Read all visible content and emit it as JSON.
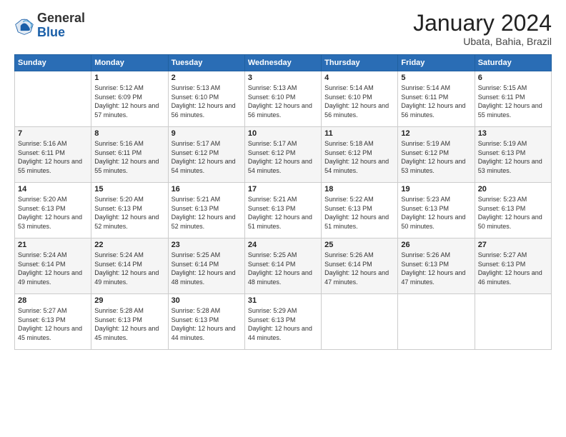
{
  "logo": {
    "general": "General",
    "blue": "Blue"
  },
  "header": {
    "month": "January 2024",
    "location": "Ubata, Bahia, Brazil"
  },
  "weekdays": [
    "Sunday",
    "Monday",
    "Tuesday",
    "Wednesday",
    "Thursday",
    "Friday",
    "Saturday"
  ],
  "weeks": [
    [
      {
        "day": "",
        "sunrise": "",
        "sunset": "",
        "daylight": ""
      },
      {
        "day": "1",
        "sunrise": "Sunrise: 5:12 AM",
        "sunset": "Sunset: 6:09 PM",
        "daylight": "Daylight: 12 hours and 57 minutes."
      },
      {
        "day": "2",
        "sunrise": "Sunrise: 5:13 AM",
        "sunset": "Sunset: 6:10 PM",
        "daylight": "Daylight: 12 hours and 56 minutes."
      },
      {
        "day": "3",
        "sunrise": "Sunrise: 5:13 AM",
        "sunset": "Sunset: 6:10 PM",
        "daylight": "Daylight: 12 hours and 56 minutes."
      },
      {
        "day": "4",
        "sunrise": "Sunrise: 5:14 AM",
        "sunset": "Sunset: 6:10 PM",
        "daylight": "Daylight: 12 hours and 56 minutes."
      },
      {
        "day": "5",
        "sunrise": "Sunrise: 5:14 AM",
        "sunset": "Sunset: 6:11 PM",
        "daylight": "Daylight: 12 hours and 56 minutes."
      },
      {
        "day": "6",
        "sunrise": "Sunrise: 5:15 AM",
        "sunset": "Sunset: 6:11 PM",
        "daylight": "Daylight: 12 hours and 55 minutes."
      }
    ],
    [
      {
        "day": "7",
        "sunrise": "Sunrise: 5:16 AM",
        "sunset": "Sunset: 6:11 PM",
        "daylight": "Daylight: 12 hours and 55 minutes."
      },
      {
        "day": "8",
        "sunrise": "Sunrise: 5:16 AM",
        "sunset": "Sunset: 6:11 PM",
        "daylight": "Daylight: 12 hours and 55 minutes."
      },
      {
        "day": "9",
        "sunrise": "Sunrise: 5:17 AM",
        "sunset": "Sunset: 6:12 PM",
        "daylight": "Daylight: 12 hours and 54 minutes."
      },
      {
        "day": "10",
        "sunrise": "Sunrise: 5:17 AM",
        "sunset": "Sunset: 6:12 PM",
        "daylight": "Daylight: 12 hours and 54 minutes."
      },
      {
        "day": "11",
        "sunrise": "Sunrise: 5:18 AM",
        "sunset": "Sunset: 6:12 PM",
        "daylight": "Daylight: 12 hours and 54 minutes."
      },
      {
        "day": "12",
        "sunrise": "Sunrise: 5:19 AM",
        "sunset": "Sunset: 6:12 PM",
        "daylight": "Daylight: 12 hours and 53 minutes."
      },
      {
        "day": "13",
        "sunrise": "Sunrise: 5:19 AM",
        "sunset": "Sunset: 6:13 PM",
        "daylight": "Daylight: 12 hours and 53 minutes."
      }
    ],
    [
      {
        "day": "14",
        "sunrise": "Sunrise: 5:20 AM",
        "sunset": "Sunset: 6:13 PM",
        "daylight": "Daylight: 12 hours and 53 minutes."
      },
      {
        "day": "15",
        "sunrise": "Sunrise: 5:20 AM",
        "sunset": "Sunset: 6:13 PM",
        "daylight": "Daylight: 12 hours and 52 minutes."
      },
      {
        "day": "16",
        "sunrise": "Sunrise: 5:21 AM",
        "sunset": "Sunset: 6:13 PM",
        "daylight": "Daylight: 12 hours and 52 minutes."
      },
      {
        "day": "17",
        "sunrise": "Sunrise: 5:21 AM",
        "sunset": "Sunset: 6:13 PM",
        "daylight": "Daylight: 12 hours and 51 minutes."
      },
      {
        "day": "18",
        "sunrise": "Sunrise: 5:22 AM",
        "sunset": "Sunset: 6:13 PM",
        "daylight": "Daylight: 12 hours and 51 minutes."
      },
      {
        "day": "19",
        "sunrise": "Sunrise: 5:23 AM",
        "sunset": "Sunset: 6:13 PM",
        "daylight": "Daylight: 12 hours and 50 minutes."
      },
      {
        "day": "20",
        "sunrise": "Sunrise: 5:23 AM",
        "sunset": "Sunset: 6:13 PM",
        "daylight": "Daylight: 12 hours and 50 minutes."
      }
    ],
    [
      {
        "day": "21",
        "sunrise": "Sunrise: 5:24 AM",
        "sunset": "Sunset: 6:14 PM",
        "daylight": "Daylight: 12 hours and 49 minutes."
      },
      {
        "day": "22",
        "sunrise": "Sunrise: 5:24 AM",
        "sunset": "Sunset: 6:14 PM",
        "daylight": "Daylight: 12 hours and 49 minutes."
      },
      {
        "day": "23",
        "sunrise": "Sunrise: 5:25 AM",
        "sunset": "Sunset: 6:14 PM",
        "daylight": "Daylight: 12 hours and 48 minutes."
      },
      {
        "day": "24",
        "sunrise": "Sunrise: 5:25 AM",
        "sunset": "Sunset: 6:14 PM",
        "daylight": "Daylight: 12 hours and 48 minutes."
      },
      {
        "day": "25",
        "sunrise": "Sunrise: 5:26 AM",
        "sunset": "Sunset: 6:14 PM",
        "daylight": "Daylight: 12 hours and 47 minutes."
      },
      {
        "day": "26",
        "sunrise": "Sunrise: 5:26 AM",
        "sunset": "Sunset: 6:13 PM",
        "daylight": "Daylight: 12 hours and 47 minutes."
      },
      {
        "day": "27",
        "sunrise": "Sunrise: 5:27 AM",
        "sunset": "Sunset: 6:13 PM",
        "daylight": "Daylight: 12 hours and 46 minutes."
      }
    ],
    [
      {
        "day": "28",
        "sunrise": "Sunrise: 5:27 AM",
        "sunset": "Sunset: 6:13 PM",
        "daylight": "Daylight: 12 hours and 45 minutes."
      },
      {
        "day": "29",
        "sunrise": "Sunrise: 5:28 AM",
        "sunset": "Sunset: 6:13 PM",
        "daylight": "Daylight: 12 hours and 45 minutes."
      },
      {
        "day": "30",
        "sunrise": "Sunrise: 5:28 AM",
        "sunset": "Sunset: 6:13 PM",
        "daylight": "Daylight: 12 hours and 44 minutes."
      },
      {
        "day": "31",
        "sunrise": "Sunrise: 5:29 AM",
        "sunset": "Sunset: 6:13 PM",
        "daylight": "Daylight: 12 hours and 44 minutes."
      },
      {
        "day": "",
        "sunrise": "",
        "sunset": "",
        "daylight": ""
      },
      {
        "day": "",
        "sunrise": "",
        "sunset": "",
        "daylight": ""
      },
      {
        "day": "",
        "sunrise": "",
        "sunset": "",
        "daylight": ""
      }
    ]
  ]
}
